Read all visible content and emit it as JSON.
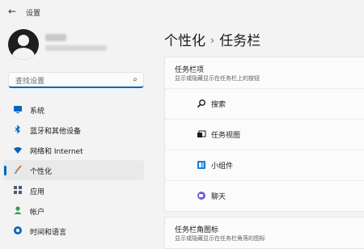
{
  "window": {
    "title": "设置"
  },
  "search": {
    "placeholder": "查找设置"
  },
  "nav": [
    {
      "label": "系统",
      "icon": "monitor-icon",
      "color": "#0067c0"
    },
    {
      "label": "蓝牙和其他设备",
      "icon": "bluetooth-icon",
      "color": "#0067c0"
    },
    {
      "label": "网络和 Internet",
      "icon": "wifi-icon",
      "color": "#0067c0"
    },
    {
      "label": "个性化",
      "icon": "brush-icon",
      "color": "#d07a2b",
      "active": true
    },
    {
      "label": "应用",
      "icon": "apps-icon",
      "color": "#4a5b74"
    },
    {
      "label": "帐户",
      "icon": "account-icon",
      "color": "#2a9d5c"
    },
    {
      "label": "时间和语言",
      "icon": "globe-icon",
      "color": "#0067c0"
    }
  ],
  "breadcrumb": {
    "parent": "个性化",
    "separator": "›",
    "current": "任务栏"
  },
  "taskbar_items": {
    "title": "任务栏项",
    "subtitle": "显示或隐藏显示在任务栏上的按钮",
    "rows": [
      {
        "label": "搜索",
        "icon": "search-icon"
      },
      {
        "label": "任务视图",
        "icon": "task-view-icon"
      },
      {
        "label": "小组件",
        "icon": "widgets-icon"
      },
      {
        "label": "聊天",
        "icon": "chat-icon"
      }
    ]
  },
  "corner_icons": {
    "title": "任务栏角图标",
    "subtitle": "显示或隐藏显示在任务栏角落的图标"
  },
  "accent_color": "#0067c0"
}
